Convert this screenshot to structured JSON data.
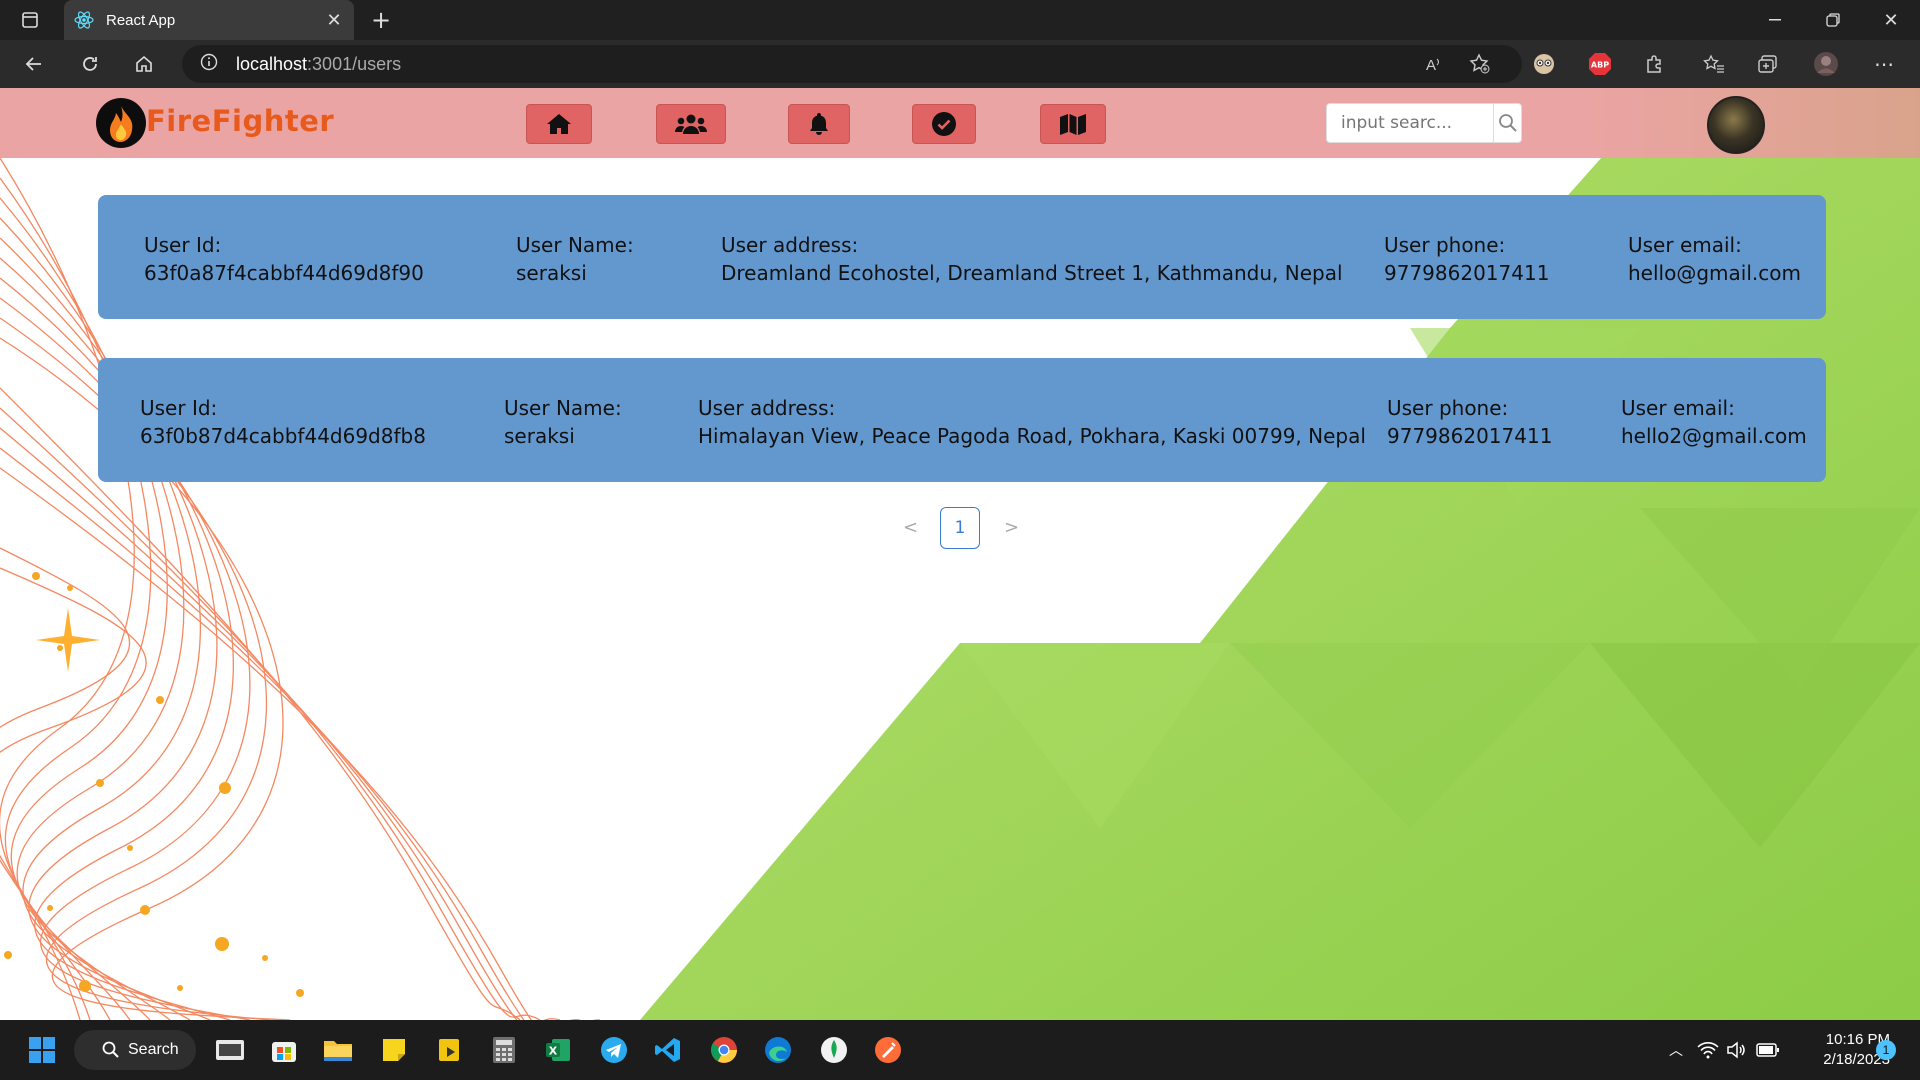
{
  "browser": {
    "tab_title": "React App",
    "url_host": "localhost",
    "url_path": ":3001/users"
  },
  "app": {
    "logo_text": "FireFighter",
    "search_placeholder": "input searc...",
    "nav_icons": [
      "home-icon",
      "users-icon",
      "bell-icon",
      "check-circle-icon",
      "map-icon"
    ]
  },
  "users": [
    {
      "id_label": "User Id:",
      "id": "63f0a87f4cabbf44d69d8f90",
      "name_label": "User Name:",
      "name": "seraksi",
      "address_label": "User address:",
      "address": "Dreamland Ecohostel, Dreamland Street 1, Kathmandu, Nepal",
      "phone_label": "User phone:",
      "phone": "9779862017411",
      "email_label": "User email:",
      "email": "hello@gmail.com"
    },
    {
      "id_label": "User Id:",
      "id": "63f0b87d4cabbf44d69d8fb8",
      "name_label": "User Name:",
      "name": "seraksi",
      "address_label": "User address:",
      "address": "Himalayan View, Peace Pagoda Road, Pokhara, Kaski 00799, Nepal",
      "phone_label": "User phone:",
      "phone": "9779862017411",
      "email_label": "User email:",
      "email": "hello2@gmail.com"
    }
  ],
  "pagination": {
    "prev": "<",
    "current": "1",
    "next": ">"
  },
  "taskbar": {
    "search_label": "Search",
    "time": "10:16 PM",
    "date": "2/18/2023",
    "notification_count": "1"
  },
  "colors": {
    "header_bg": "#eba4a4",
    "nav_button": "#e06464",
    "card_bg": "#6398cf",
    "logo_text": "#e85a1c",
    "background_green": "#9ed256"
  }
}
